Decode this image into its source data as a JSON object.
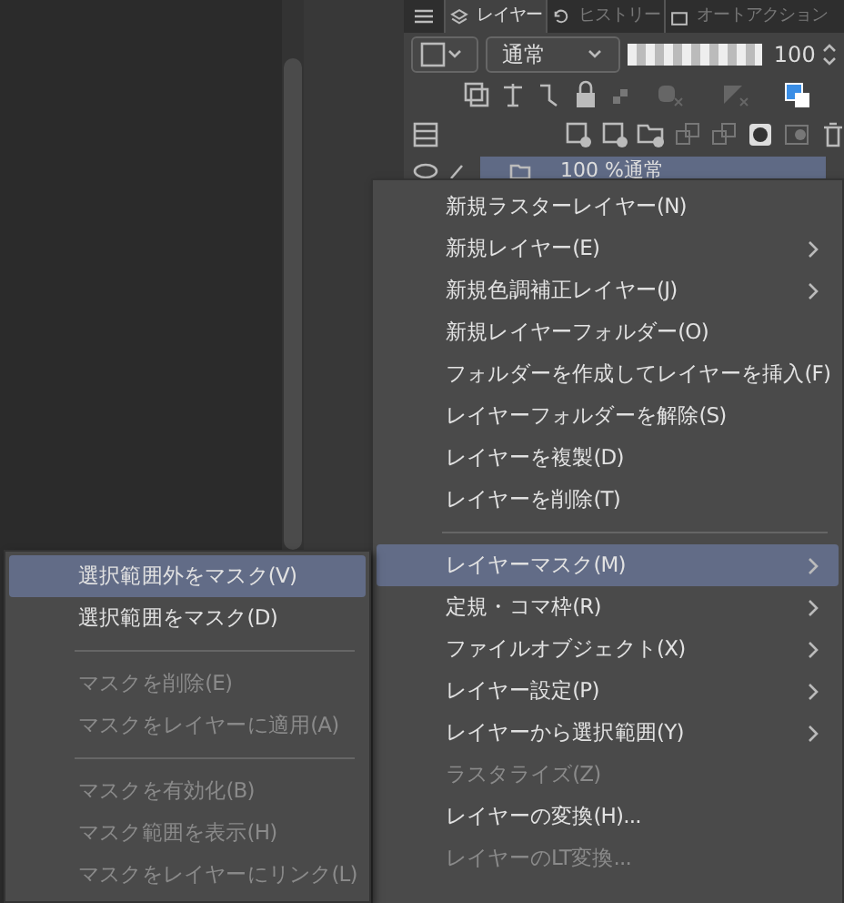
{
  "panel_tabs": [
    {
      "label": "レイヤー",
      "selected": true
    },
    {
      "label": "ヒストリー",
      "selected": false
    },
    {
      "label": "オートアクション",
      "selected": false
    }
  ],
  "blend_mode": "通常",
  "opacity": {
    "level": 1,
    "reading": "100"
  },
  "layer": {
    "label": "100 %通常",
    "selected": true
  },
  "context_menu": [
    {
      "kind": "item",
      "label": "新規ラスターレイヤー(N)",
      "submenu": false,
      "disabled": false,
      "selected": false
    },
    {
      "kind": "item",
      "label": "新規レイヤー(E)",
      "submenu": true,
      "disabled": false,
      "selected": false
    },
    {
      "kind": "item",
      "label": "新規色調補正レイヤー(J)",
      "submenu": true,
      "disabled": false,
      "selected": false
    },
    {
      "kind": "item",
      "label": "新規レイヤーフォルダー(O)",
      "submenu": false,
      "disabled": false,
      "selected": false
    },
    {
      "kind": "item",
      "label": "フォルダーを作成してレイヤーを挿入(F)",
      "submenu": false,
      "disabled": false,
      "selected": false
    },
    {
      "kind": "item",
      "label": "レイヤーフォルダーを解除(S)",
      "submenu": false,
      "disabled": false,
      "selected": false
    },
    {
      "kind": "item",
      "label": "レイヤーを複製(D)",
      "submenu": false,
      "disabled": false,
      "selected": false
    },
    {
      "kind": "item",
      "label": "レイヤーを削除(T)",
      "submenu": false,
      "disabled": false,
      "selected": false
    },
    {
      "kind": "separator"
    },
    {
      "kind": "item",
      "label": "レイヤーマスク(M)",
      "submenu": true,
      "disabled": false,
      "selected": true
    },
    {
      "kind": "item",
      "label": "定規・コマ枠(R)",
      "submenu": true,
      "disabled": false,
      "selected": false
    },
    {
      "kind": "item",
      "label": "ファイルオブジェクト(X)",
      "submenu": true,
      "disabled": false,
      "selected": false
    },
    {
      "kind": "item",
      "label": "レイヤー設定(P)",
      "submenu": true,
      "disabled": false,
      "selected": false
    },
    {
      "kind": "item",
      "label": "レイヤーから選択範囲(Y)",
      "submenu": true,
      "disabled": false,
      "selected": false
    },
    {
      "kind": "item",
      "label": "ラスタライズ(Z)",
      "submenu": false,
      "disabled": true,
      "selected": false
    },
    {
      "kind": "item",
      "label": "レイヤーの変換(H)...",
      "submenu": false,
      "disabled": false,
      "selected": false
    },
    {
      "kind": "item",
      "label": "レイヤーのLT変換...",
      "submenu": false,
      "disabled": true,
      "selected": false
    }
  ],
  "submenu": [
    {
      "kind": "item",
      "label": "選択範囲外をマスク(V)",
      "disabled": false,
      "selected": true
    },
    {
      "kind": "item",
      "label": "選択範囲をマスク(D)",
      "disabled": false,
      "selected": false
    },
    {
      "kind": "separator"
    },
    {
      "kind": "item",
      "label": "マスクを削除(E)",
      "disabled": true,
      "selected": false
    },
    {
      "kind": "item",
      "label": "マスクをレイヤーに適用(A)",
      "disabled": true,
      "selected": false
    },
    {
      "kind": "separator"
    },
    {
      "kind": "item",
      "label": "マスクを有効化(B)",
      "disabled": true,
      "selected": false
    },
    {
      "kind": "item",
      "label": "マスク範囲を表示(H)",
      "disabled": true,
      "selected": false
    },
    {
      "kind": "item",
      "label": "マスクをレイヤーにリンク(L)",
      "disabled": true,
      "selected": false
    }
  ]
}
